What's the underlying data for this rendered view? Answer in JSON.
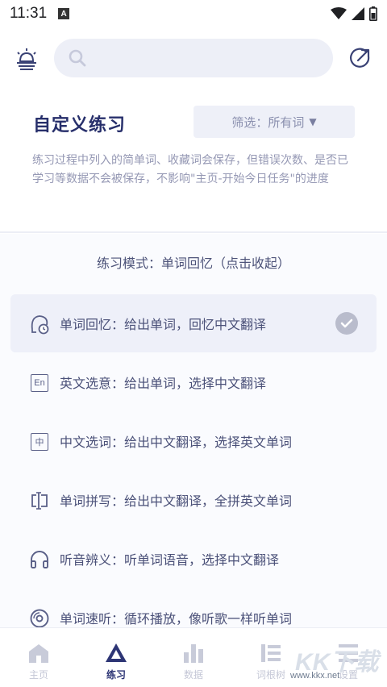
{
  "status_bar": {
    "time": "11:31",
    "notification_badge": "A"
  },
  "search": {
    "placeholder": ""
  },
  "header": {
    "title": "自定义练习",
    "filter_label": "筛选：所有词",
    "description": "练习过程中列入的简单词、收藏词会保存，但错误次数、是否已学习等数据不会被保存，不影响\"主页-开始今日任务\"的进度"
  },
  "mode_panel": {
    "header": "练习模式：单词回忆（点击收起）",
    "modes": [
      {
        "label": "单词回忆：给出单词，回忆中文翻译",
        "icon": "recall-clock-icon",
        "selected": true
      },
      {
        "label": "英文选意：给出单词，选择中文翻译",
        "icon": "en-box-icon",
        "icon_text": "En",
        "selected": false
      },
      {
        "label": "中文选词：给出中文翻译，选择英文单词",
        "icon": "zh-box-icon",
        "icon_text": "中",
        "selected": false
      },
      {
        "label": "单词拼写：给出中文翻译，全拼英文单词",
        "icon": "spell-cursor-icon",
        "selected": false
      },
      {
        "label": "听音辨义：听单词语音，选择中文翻译",
        "icon": "headphones-icon",
        "selected": false
      },
      {
        "label": "单词速听：循环播放，像听歌一样听单词",
        "icon": "disc-icon",
        "selected": false
      }
    ]
  },
  "bottom_nav": {
    "items": [
      {
        "label": "主页",
        "icon": "home-icon",
        "active": false
      },
      {
        "label": "练习",
        "icon": "practice-triangle-icon",
        "active": true
      },
      {
        "label": "数据",
        "icon": "bar-chart-icon",
        "active": false
      },
      {
        "label": "词根树",
        "icon": "word-tree-icon",
        "active": false
      },
      {
        "label": "设置",
        "icon": "settings-icon",
        "active": false
      }
    ]
  },
  "watermark": {
    "text": "KK下载",
    "sub": "www.kkx.net"
  },
  "colors": {
    "accent": "#272f6b",
    "panel_bg": "#fafbfe",
    "selected_bg": "#eef0f9",
    "muted": "#9598b4"
  }
}
